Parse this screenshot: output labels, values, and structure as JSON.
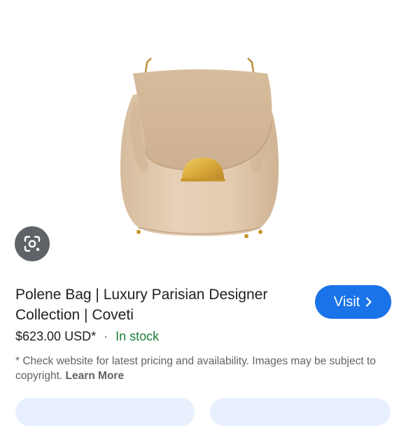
{
  "product": {
    "title": "Polene Bag | Luxury Parisian Designer Collection | Coveti",
    "price": "$623.00 USD*",
    "separator": "·",
    "stock_status": "In stock"
  },
  "visit_button": {
    "label": "Visit",
    "icon": "chevron-right-icon"
  },
  "lens_button": {
    "icon": "google-lens-icon"
  },
  "disclaimer": {
    "text": "* Check website for latest pricing and availability. Images may be subject to copyright.",
    "learn_more": "Learn More"
  },
  "colors": {
    "accent": "#1a73e8",
    "stock": "#188038",
    "text": "#202124",
    "muted": "#5f6368",
    "bag": "#dcc4a6",
    "clasp": "#d9a93a"
  }
}
